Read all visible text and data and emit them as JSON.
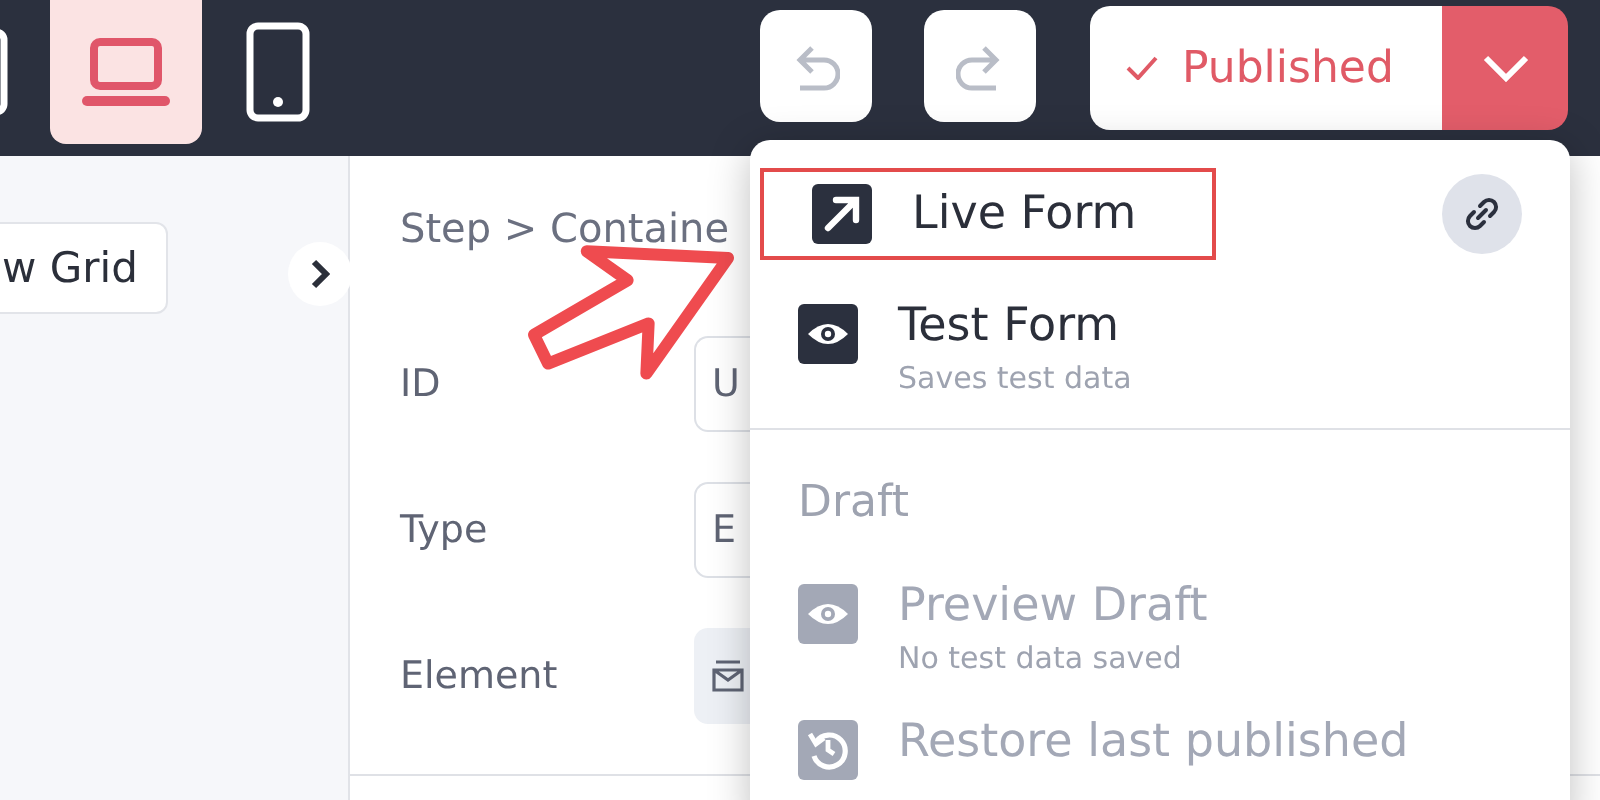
{
  "toolbar": {
    "devices": [
      {
        "kind": "tablet",
        "selected": false
      },
      {
        "kind": "desktop",
        "selected": true
      },
      {
        "kind": "phone",
        "selected": false
      }
    ],
    "publish_button": {
      "label": "Published"
    }
  },
  "left_pane": {
    "button": "w Grid"
  },
  "properties": {
    "breadcrumb": "Step > Containe",
    "fields": [
      {
        "kind": "text",
        "label": "ID",
        "value": "U"
      },
      {
        "kind": "text",
        "label": "Type",
        "value": "E"
      },
      {
        "kind": "icon",
        "label": "Element"
      }
    ]
  },
  "menu": {
    "items": [
      {
        "kind": "item",
        "label": "Live Form",
        "highlighted": true,
        "link_button": true,
        "disabled": false
      },
      {
        "kind": "item",
        "label": "Test Form",
        "subtitle": "Saves test data",
        "disabled": false
      },
      {
        "kind": "divider"
      },
      {
        "kind": "heading",
        "label": "Draft"
      },
      {
        "kind": "item",
        "label": "Preview Draft",
        "subtitle": "No test data saved",
        "disabled": true
      },
      {
        "kind": "item",
        "label": "Restore last published",
        "disabled": true
      }
    ]
  }
}
